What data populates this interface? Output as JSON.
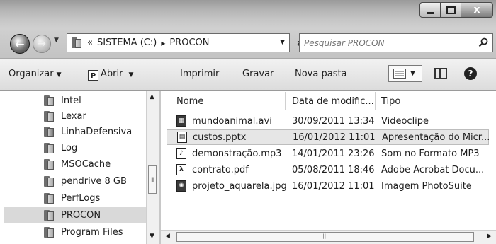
{
  "window": {
    "minimize_label": "",
    "maximize_label": "",
    "close_label": "x"
  },
  "address": {
    "overflow": "«",
    "crumbs": [
      "SISTEMA (C:)",
      "PROCON"
    ],
    "separator": "▸"
  },
  "search": {
    "placeholder": "Pesquisar PROCON"
  },
  "toolbar": {
    "organize_label": "Organizar",
    "open_label": "Abrir",
    "open_icon_letter": "P",
    "print_label": "Imprimir",
    "burn_label": "Gravar",
    "new_folder_label": "Nova pasta",
    "help_label": "?"
  },
  "nav": {
    "items": [
      {
        "label": "Intel",
        "icon": "folder-icon"
      },
      {
        "label": "Lexar",
        "icon": "folder-icon"
      },
      {
        "label": "LinhaDefensiva",
        "icon": "shared-folder-icon"
      },
      {
        "label": "Log",
        "icon": "folder-icon"
      },
      {
        "label": "MSOCache",
        "icon": "folder-icon"
      },
      {
        "label": "pendrive 8 GB",
        "icon": "folder-icon"
      },
      {
        "label": "PerfLogs",
        "icon": "folder-icon"
      },
      {
        "label": "PROCON",
        "icon": "folder-icon",
        "selected": true
      },
      {
        "label": "Program Files",
        "icon": "folder-icon"
      }
    ]
  },
  "files": {
    "columns": [
      "Nome",
      "Data de modific...",
      "Tipo"
    ],
    "rows": [
      {
        "name": "mundoanimal.avi",
        "date": "30/09/2011 13:34",
        "type": "Videoclipe",
        "icon": "video-file-icon"
      },
      {
        "name": "custos.pptx",
        "date": "16/01/2012 11:01",
        "type": "Apresentação do Micr...",
        "icon": "presentation-file-icon",
        "selected": true
      },
      {
        "name": "demonstração.mp3",
        "date": "14/01/2011 23:26",
        "type": "Som no Formato MP3",
        "icon": "audio-file-icon"
      },
      {
        "name": "contrato.pdf",
        "date": "05/08/2011 18:46",
        "type": "Adobe Acrobat Docu...",
        "icon": "pdf-file-icon"
      },
      {
        "name": "projeto_aquarela.jpg",
        "date": "16/01/2012 11:01",
        "type": "Imagem PhotoSuite",
        "icon": "image-file-icon"
      }
    ]
  },
  "colors": {
    "selection": "#d9d9d9",
    "titlebar": "#b4b4b4"
  }
}
